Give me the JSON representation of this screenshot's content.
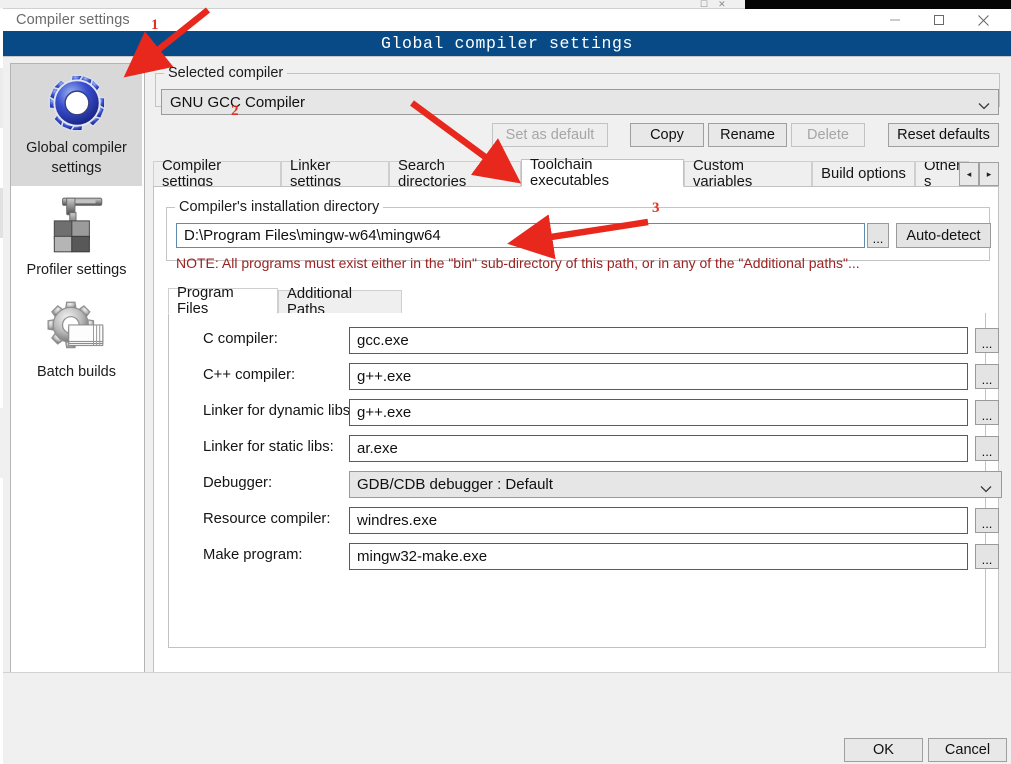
{
  "window": {
    "parent_title": "Compiler settings",
    "minimize_icon": "minimize-icon",
    "maximize_icon": "maximize-icon",
    "close_icon": "close-icon"
  },
  "dialog": {
    "title": "Global compiler settings",
    "title_bar_color": "#084a86"
  },
  "annotations": [
    {
      "label": "1"
    },
    {
      "label": "2"
    },
    {
      "label": "3"
    }
  ],
  "sidebar": {
    "items": [
      {
        "label": "Global compiler settings",
        "icon": "gear-icon",
        "selected": true
      },
      {
        "label": "Profiler settings",
        "icon": "caliper-icon",
        "selected": false
      },
      {
        "label": "Batch builds",
        "icon": "gear-stack-icon",
        "selected": false
      }
    ]
  },
  "selected_compiler": {
    "group_label": "Selected compiler",
    "value": "GNU GCC Compiler",
    "dropdown_icon": "chevron-down-icon"
  },
  "action_buttons": [
    {
      "label": "Set as default",
      "disabled": true
    },
    {
      "label": "Copy",
      "disabled": false
    },
    {
      "label": "Rename",
      "disabled": false
    },
    {
      "label": "Delete",
      "disabled": true
    },
    {
      "label": "Reset defaults",
      "disabled": false
    }
  ],
  "tabs": {
    "items": [
      {
        "label": "Compiler settings",
        "active": false
      },
      {
        "label": "Linker settings",
        "active": false
      },
      {
        "label": "Search directories",
        "active": false
      },
      {
        "label": "Toolchain executables",
        "active": true
      },
      {
        "label": "Custom variables",
        "active": false
      },
      {
        "label": "Build options",
        "active": false
      },
      {
        "label": "Other s",
        "active": false
      }
    ],
    "scroll_left_icon": "◂",
    "scroll_right_icon": "▸"
  },
  "install_dir": {
    "group_label": "Compiler's installation directory",
    "value": "D:\\Program Files\\mingw-w64\\mingw64",
    "browse_label": "...",
    "autodetect_label": "Auto-detect",
    "note": "NOTE: All programs must exist either in the \"bin\" sub-directory of this path, or in any of the \"Additional paths\"..."
  },
  "inner_tabs": [
    {
      "label": "Program Files",
      "active": true
    },
    {
      "label": "Additional Paths",
      "active": false
    }
  ],
  "program_files": {
    "rows": [
      {
        "label": "C compiler:",
        "value": "gcc.exe",
        "control": "text",
        "browse_label": "..."
      },
      {
        "label": "C++ compiler:",
        "value": "g++.exe",
        "control": "text",
        "browse_label": "..."
      },
      {
        "label": "Linker for dynamic libs:",
        "value": "g++.exe",
        "control": "text",
        "browse_label": "..."
      },
      {
        "label": "Linker for static libs:",
        "value": "ar.exe",
        "control": "text",
        "browse_label": "..."
      },
      {
        "label": "Debugger:",
        "value": "GDB/CDB debugger : Default",
        "control": "combo",
        "browse_label": ""
      },
      {
        "label": "Resource compiler:",
        "value": "windres.exe",
        "control": "text",
        "browse_label": "..."
      },
      {
        "label": "Make program:",
        "value": "mingw32-make.exe",
        "control": "text",
        "browse_label": "..."
      }
    ]
  },
  "footer": {
    "ok_label": "OK",
    "cancel_label": "Cancel"
  }
}
